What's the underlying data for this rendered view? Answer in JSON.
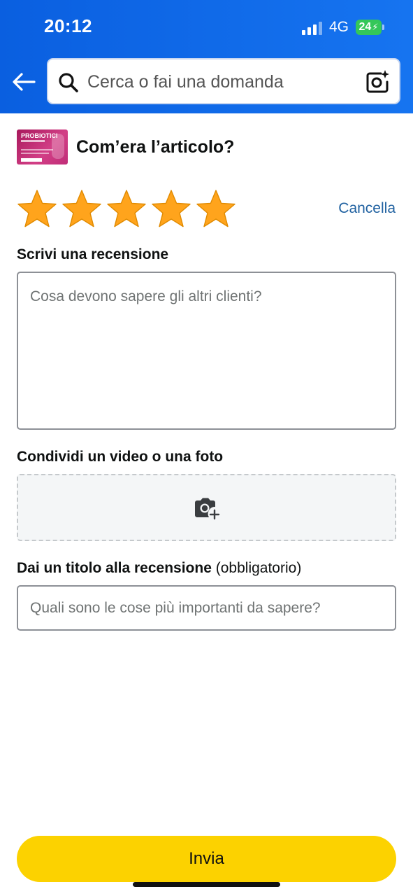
{
  "status_bar": {
    "time": "20:12",
    "network": "4G",
    "battery": "24"
  },
  "search": {
    "placeholder": "Cerca o fai una domanda"
  },
  "product": {
    "thumb_text": "PROBIOTICI"
  },
  "review": {
    "heading": "Com’era l’articolo?",
    "rating": 5,
    "rating_max": 5,
    "cancel_label": "Cancella",
    "write_label": "Scrivi una recensione",
    "write_placeholder": "Cosa devono sapere gli altri clienti?",
    "media_label": "Condividi un video o una foto",
    "title_label": "Dai un titolo alla recensione",
    "title_required": "(obbligatorio)",
    "title_placeholder": "Quali sono le cose più importanti da sapere?",
    "submit_label": "Invia"
  },
  "icons": {
    "back": "arrow-left-icon",
    "search": "search-icon",
    "camera_search": "camera-sparkle-icon",
    "star": "star-icon",
    "add_photo": "camera-plus-icon"
  },
  "colors": {
    "header": "#0a5fe0",
    "star": "#ffa41c",
    "link": "#2162a1",
    "button": "#fcd200",
    "battery": "#34c759"
  }
}
